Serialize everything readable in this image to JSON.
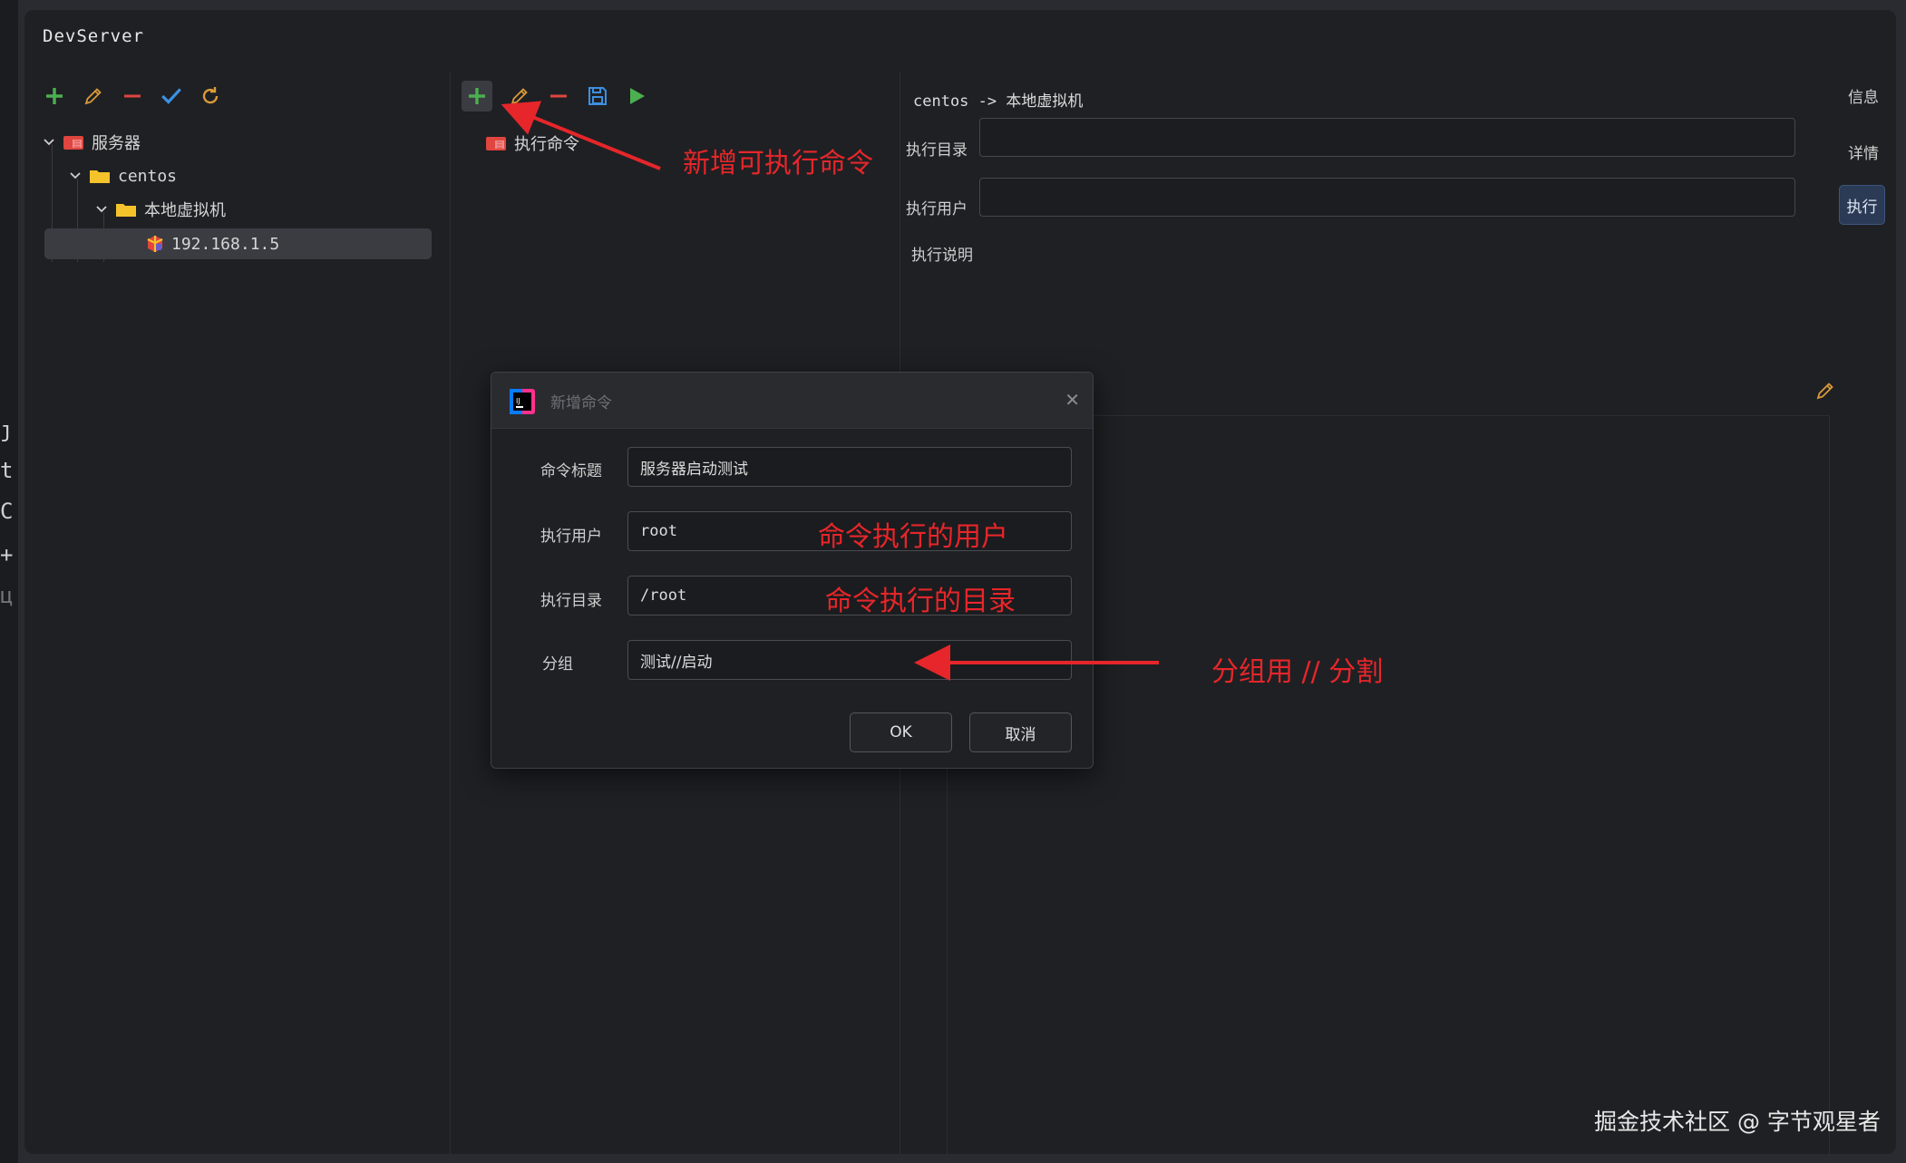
{
  "app": {
    "title": "DevServer"
  },
  "left_edge": {
    "fragments": [
      "ȷ",
      "t",
      "C",
      "+",
      "ц"
    ]
  },
  "tree": {
    "root": "服务器",
    "group": "centos",
    "subgroup": "本地虚拟机",
    "host": "192.168.1.5"
  },
  "middle": {
    "command_item": "执行命令"
  },
  "right": {
    "breadcrumb": "centos -> 本地虚拟机",
    "fields": {
      "exec_dir": "执行目录",
      "exec_user": "执行用户",
      "exec_desc": "执行说明"
    },
    "side": {
      "info": "信息",
      "details": "详情",
      "execute": "执行"
    }
  },
  "dialog": {
    "title": "新增命令",
    "labels": {
      "cmd_title": "命令标题",
      "exec_user": "执行用户",
      "exec_dir": "执行目录",
      "group": "分组"
    },
    "values": {
      "cmd_title": "服务器启动测试",
      "exec_user": "root",
      "exec_dir": "/root",
      "group": "测试//启动"
    },
    "ok": "OK",
    "cancel": "取消"
  },
  "annotations": {
    "add_command": "新增可执行命令",
    "user_note": "命令执行的用户",
    "dir_note": "命令执行的目录",
    "group_note": "分组用 // 分割"
  },
  "watermark": "掘金技术社区 @ 字节观星者",
  "colors": {
    "green": "#4caf50",
    "orange": "#d99a3a",
    "red": "#e0453f",
    "blue": "#3d8fe0",
    "folder": "#f4c32b",
    "annotation": "#e6262a"
  }
}
